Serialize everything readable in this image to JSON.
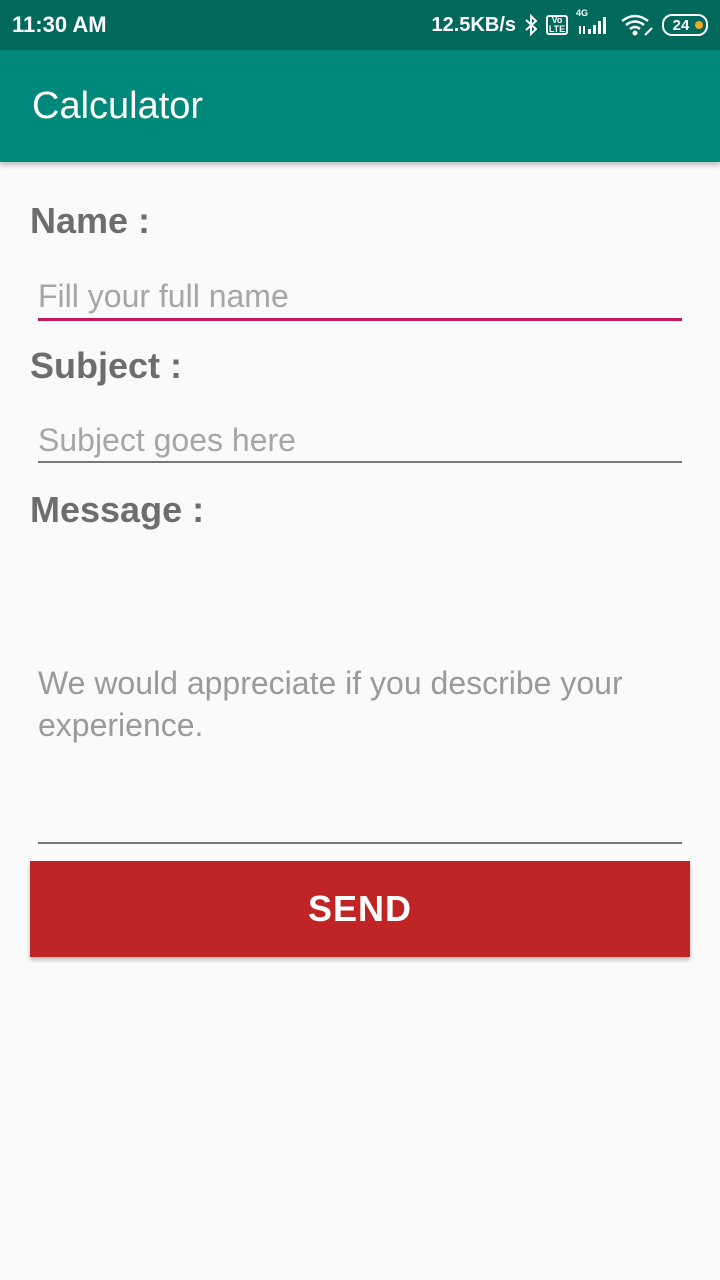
{
  "status_bar": {
    "time": "11:30 AM",
    "speed": "12.5KB/s",
    "bluetooth_icon": "bluetooth-icon",
    "volte_text": [
      "Vo",
      "LTE"
    ],
    "network": "4G",
    "battery": "24"
  },
  "app_bar": {
    "title": "Calculator"
  },
  "form": {
    "name_label": "Name :",
    "name_placeholder": "Fill your full name",
    "subject_label": "Subject :",
    "subject_placeholder": "Subject goes here",
    "message_label": "Message :",
    "message_placeholder": "We would appreciate if you describe your experience.",
    "send_label": "SEND"
  },
  "colors": {
    "status_bar": "#00695c",
    "app_bar": "#00897b",
    "accent_underline": "#c2185b",
    "send_button": "#c02526"
  }
}
